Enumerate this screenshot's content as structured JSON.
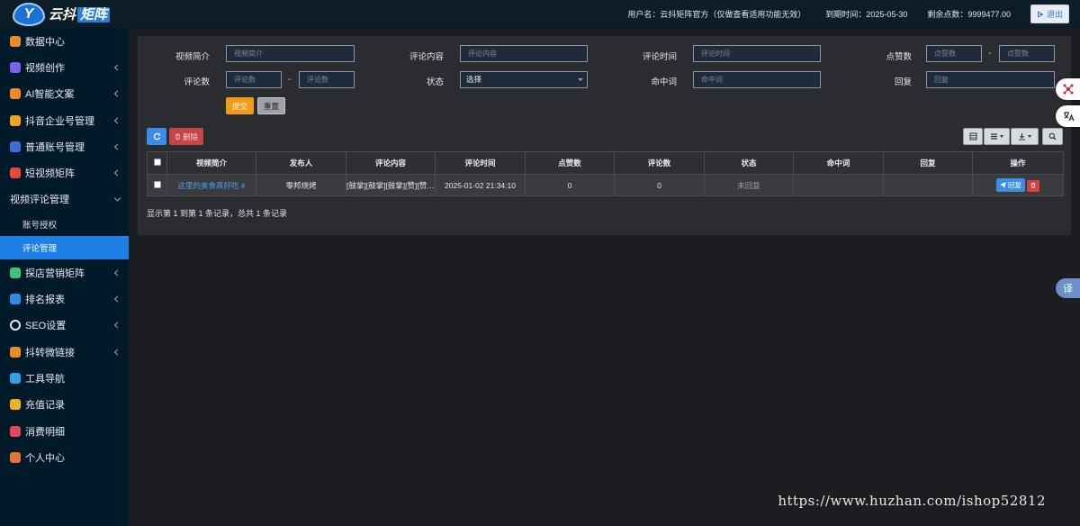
{
  "header": {
    "logo_badge": "Y",
    "logo_text_a": "云抖",
    "logo_text_b": "矩阵",
    "username": "用户名：云抖矩阵官方（仅做查看适用功能无效）",
    "expire": "到期时间：2025-05-30",
    "points": "剩余点数：9999477.00",
    "logout": "退出"
  },
  "sidebar": {
    "items": [
      {
        "label": "数据中心",
        "icon": "dashboard-icon",
        "color": "#f08a24",
        "chevron": false
      },
      {
        "label": "视频创作",
        "icon": "video-create-icon",
        "color": "#7b62e6",
        "chevron": true
      },
      {
        "label": "AI智能文案",
        "icon": "ai-icon",
        "color": "#f08a24",
        "chevron": true
      },
      {
        "label": "抖音企业号管理",
        "icon": "enterprise-icon",
        "color": "#f0a324",
        "chevron": true
      },
      {
        "label": "普通账号管理",
        "icon": "account-icon",
        "color": "#3a6fd8",
        "chevron": true
      },
      {
        "label": "短视频矩阵",
        "icon": "short-video-icon",
        "color": "#e34a3a",
        "chevron": true
      },
      {
        "label": "视频评论管理",
        "icon": "",
        "color": "",
        "chevron": true,
        "open": true
      }
    ],
    "sub_items": [
      {
        "label": "账号授权",
        "active": false
      },
      {
        "label": "评论管理",
        "active": true
      }
    ],
    "items_after": [
      {
        "label": "探店营销矩阵",
        "icon": "store-icon",
        "color": "#3fc27a",
        "chevron": true
      },
      {
        "label": "排名报表",
        "icon": "ranking-icon",
        "color": "#2f8ce6",
        "chevron": true
      },
      {
        "label": "SEO设置",
        "icon": "seo-icon",
        "color": "#e8e8e8",
        "chevron": true
      },
      {
        "label": "抖转微链接",
        "icon": "link-icon",
        "color": "#f08a24",
        "chevron": true
      },
      {
        "label": "工具导航",
        "icon": "tools-icon",
        "color": "#2fa3e6",
        "chevron": false
      },
      {
        "label": "充值记录",
        "icon": "recharge-icon",
        "color": "#f0b024",
        "chevron": false
      },
      {
        "label": "消费明细",
        "icon": "consume-icon",
        "color": "#e3475a",
        "chevron": false
      },
      {
        "label": "个人中心",
        "icon": "user-icon",
        "color": "#e8703a",
        "chevron": false
      }
    ]
  },
  "filters": {
    "video_intro_label": "视频简介",
    "video_intro_ph": "视频简介",
    "comment_content_label": "评论内容",
    "comment_content_ph": "评论内容",
    "comment_time_label": "评论时间",
    "comment_time_ph": "评论时间",
    "likes_label": "点赞数",
    "likes_ph_min": "点赞数",
    "likes_ph_max": "点赞数",
    "comments_label": "评论数",
    "comments_ph_min": "评论数",
    "comments_ph_max": "评论数",
    "status_label": "状态",
    "status_value": "选择",
    "hit_word_label": "命中词",
    "hit_word_ph": "命中词",
    "reply_label": "回复",
    "reply_ph": "回复",
    "dash": "-",
    "submit": "提交",
    "reset": "重置"
  },
  "toolbar": {
    "delete": "删除"
  },
  "table": {
    "headers": [
      "视频简介",
      "发布人",
      "评论内容",
      "评论时间",
      "点赞数",
      "评论数",
      "状态",
      "命中词",
      "回复",
      "操作"
    ],
    "rows": [
      {
        "video_intro": "这里的美食真好吃 #",
        "publisher": "零邦烧烤",
        "comment": "[鼓掌][鼓掌][鼓掌][赞][赞][赞]",
        "time": "2025-01-02 21:34:10",
        "likes": "0",
        "comments": "0",
        "status": "未回复",
        "hit_word": "",
        "reply": "",
        "reply_btn": "回复"
      }
    ]
  },
  "pager": "显示第 1 到第 1 条记录，总共 1 条记录",
  "translate_btn": "译",
  "watermark": "https://www.huzhan.com/ishop52812"
}
